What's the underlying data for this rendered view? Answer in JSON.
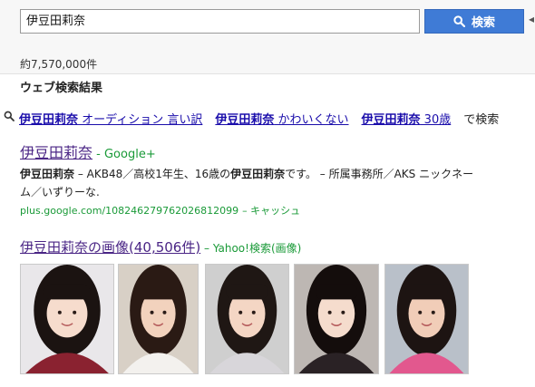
{
  "search": {
    "query": "伊豆田莉奈",
    "button_label": "検索",
    "result_count": "約7,570,000件"
  },
  "section_title": "ウェブ検索結果",
  "related": {
    "items": [
      {
        "bold": "伊豆田莉奈",
        "rest": " オーディション 言い訳"
      },
      {
        "bold": "伊豆田莉奈",
        "rest": " かわいくない"
      },
      {
        "bold": "伊豆田莉奈",
        "rest": " 30歳"
      }
    ],
    "suffix": "で検索"
  },
  "result": {
    "title": "伊豆田莉奈",
    "source": " - Google+",
    "snippet_1a": "伊豆田莉奈",
    "snippet_1b": " – AKB48／高校1年生、16歳の",
    "snippet_1c": "伊豆田莉奈",
    "snippet_1d": "です。 – 所属事務所／AKS ニックネー",
    "snippet_2": "ム／いずりーな.",
    "url": "plus.google.com/108246279762026812099",
    "cache": "– キャッシュ"
  },
  "images": {
    "title": "伊豆田莉奈の画像(40,506件)",
    "source": " – Yahoo!検索(画像)",
    "thumbs": [
      {
        "bg": "#e9e7ea",
        "skin": "#f6dccd",
        "hair": "#1b1311",
        "top": "#8a2230"
      },
      {
        "bg": "#d8d0c6",
        "skin": "#f2d2bd",
        "hair": "#2a1a14",
        "top": "#f3f1ee"
      },
      {
        "bg": "#cfcfcf",
        "skin": "#f4d6c4",
        "hair": "#1f1714",
        "top": "#d8d6da"
      },
      {
        "bg": "#bdb7b3",
        "skin": "#f5dccd",
        "hair": "#140d0c",
        "top": "#2a2225"
      },
      {
        "bg": "#b9c0c9",
        "skin": "#f1cdb8",
        "hair": "#1d1412",
        "top": "#e2588e"
      }
    ]
  },
  "colors": {
    "link_visited": "#4a2585",
    "link": "#1a0dab",
    "green": "#1a9a38",
    "button": "#3f7bd6"
  }
}
